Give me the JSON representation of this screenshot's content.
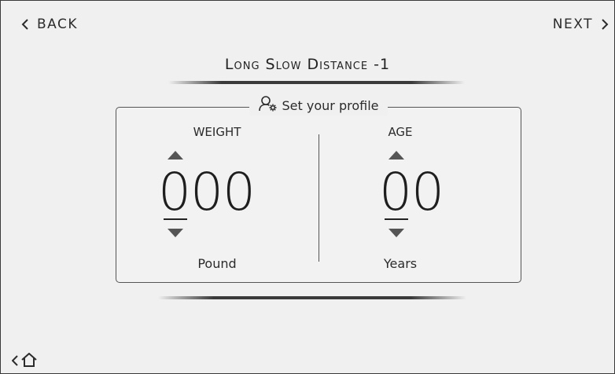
{
  "nav": {
    "back_label": "BACK",
    "next_label": "NEXT"
  },
  "workout": {
    "title": "Long Slow Distance -1"
  },
  "profile": {
    "legend": "Set your profile",
    "weight": {
      "label": "WEIGHT",
      "value": "000",
      "unit": "Pound"
    },
    "age": {
      "label": "AGE",
      "value": "00",
      "unit": "Years"
    }
  },
  "icons": {
    "back": "chevron-left-icon",
    "next": "chevron-right-icon",
    "profile": "user-settings-icon",
    "home": "home-icon"
  },
  "colors": {
    "background": "#f0f0f0",
    "text": "#2b2b2b",
    "border": "#555555"
  }
}
